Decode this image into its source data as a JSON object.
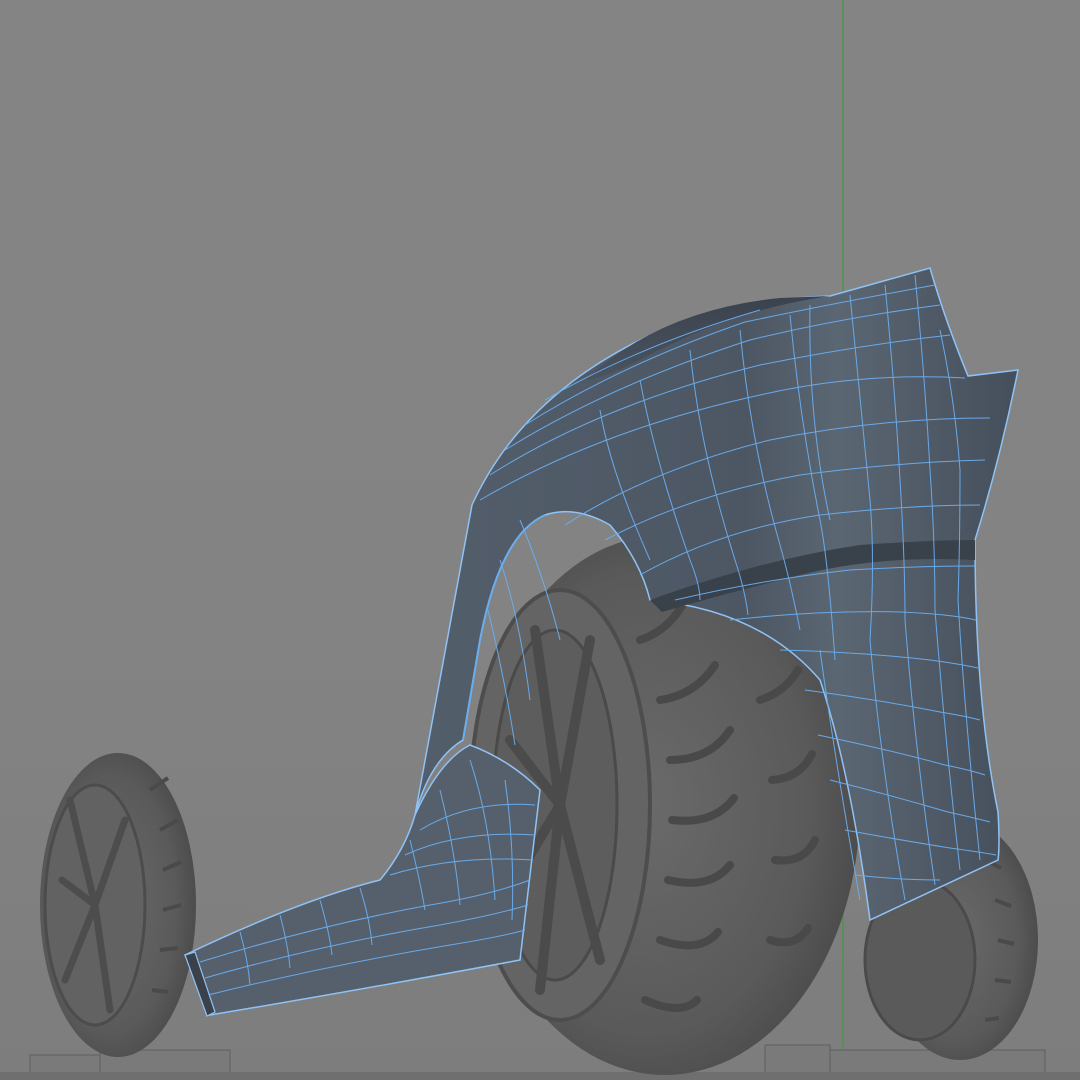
{
  "app": {
    "view": "perspective-viewport",
    "mode": "retopology-over-scan"
  },
  "scene": {
    "objects": [
      {
        "id": "scan-wheel-rear-left",
        "kind": "scan-mesh",
        "label": ""
      },
      {
        "id": "scan-wheel-front",
        "kind": "scan-mesh",
        "label": ""
      },
      {
        "id": "scan-wheel-rear-right",
        "kind": "scan-mesh",
        "label": ""
      },
      {
        "id": "retopo-body-panel",
        "kind": "poly-mesh",
        "label": ""
      }
    ],
    "axis": {
      "name": "y-axis",
      "color": "#3f9a3f"
    }
  },
  "colors": {
    "viewport_bg": "#838383",
    "scan_mesh": "#5f5f5f",
    "poly_face": "#4c5663",
    "wire": "#6aaef0",
    "ground_block": "#7c7c7c"
  }
}
